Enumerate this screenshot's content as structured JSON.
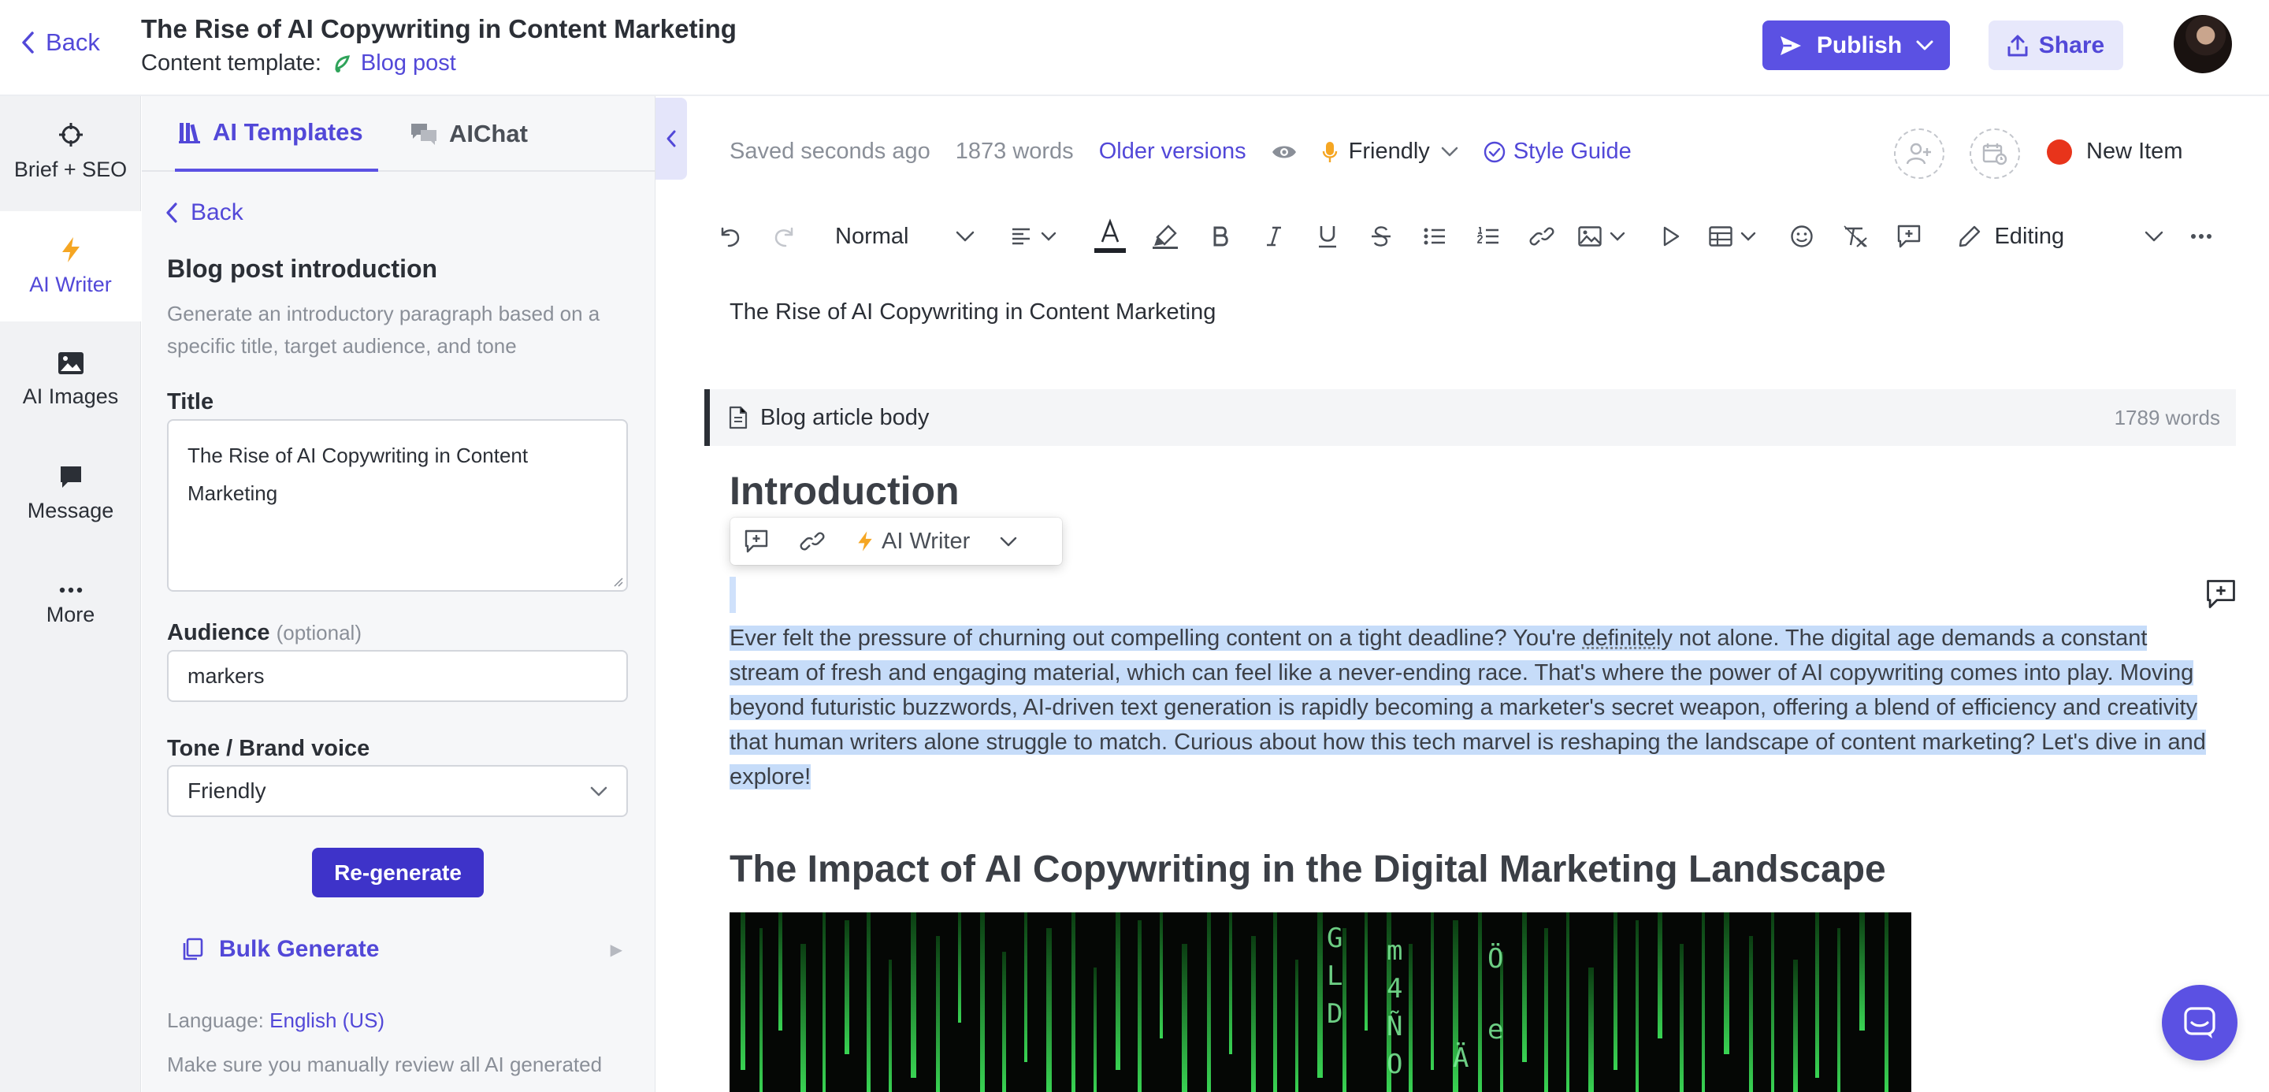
{
  "header": {
    "back_label": "Back",
    "doc_title": "The Rise of AI Copywriting in Content Marketing",
    "template_label": "Content template:",
    "template_value": "Blog post",
    "publish_label": "Publish",
    "share_label": "Share"
  },
  "rail": {
    "items": [
      {
        "label": "Brief + SEO",
        "icon": "crosshair-icon"
      },
      {
        "label": "AI Writer",
        "icon": "lightning-icon",
        "active": true
      },
      {
        "label": "AI Images",
        "icon": "image-icon"
      },
      {
        "label": "Message",
        "icon": "message-icon"
      },
      {
        "label": "More",
        "icon": "more-icon"
      }
    ]
  },
  "panel": {
    "tabs": [
      {
        "label": "AI Templates",
        "active": true
      },
      {
        "label": "AIChat",
        "active": false
      }
    ],
    "back_label": "Back",
    "section_title": "Blog post introduction",
    "section_desc": "Generate an introductory paragraph based on a specific title, target audience, and tone",
    "title_label": "Title",
    "title_value": "The Rise of AI Copywriting in Content Marketing",
    "audience_label": "Audience",
    "audience_optional": "(optional)",
    "audience_value": "markers",
    "tone_label": "Tone / Brand voice",
    "tone_value": "Friendly",
    "regenerate_label": "Re-generate",
    "bulk_label": "Bulk Generate",
    "language_label": "Language:",
    "language_value": "English (US)",
    "disclaimer": "Make sure you manually review all AI generated"
  },
  "editor": {
    "saved": "Saved seconds ago",
    "words": "1873 words",
    "older_versions": "Older versions",
    "voice": "Friendly",
    "style_guide": "Style Guide",
    "new_item": "New Item",
    "block_style": "Normal",
    "mode": "Editing",
    "title": "The Rise of AI Copywriting in Content Marketing",
    "block_label": "Blog article body",
    "block_words": "1789 words",
    "heading_intro": "Introduction",
    "float_ai_writer": "AI Writer",
    "para_pre": "Ever felt the pressure of churning out compelling content on a tight deadline? You're ",
    "para_word": "definitely",
    "para_post": " not alone. The digital age demands a constant stream of fresh and engaging material, which can feel like a never-ending race. That's where the power of AI copywriting comes into play. Moving beyond futuristic buzzwords, AI-driven text generation is rapidly becoming a marketer's secret weapon, offering a blend of efficiency and creativity that human writers alone struggle to match. Curious about how this tech marvel is reshaping the landscape of content marketing? Let's dive in and explore!",
    "heading_impact": "The Impact of AI Copywriting in the Digital Marketing Landscape",
    "image_glyphs": [
      "G",
      "L",
      "D",
      "m",
      "4",
      "Ñ",
      "O",
      "Ö",
      "e",
      "Ä"
    ]
  },
  "colors": {
    "accent": "#5b51e3",
    "accent_text": "#5248d8",
    "regen": "#3e33c9",
    "selection": "#c6dcf9",
    "red_dot": "#e8341b"
  }
}
